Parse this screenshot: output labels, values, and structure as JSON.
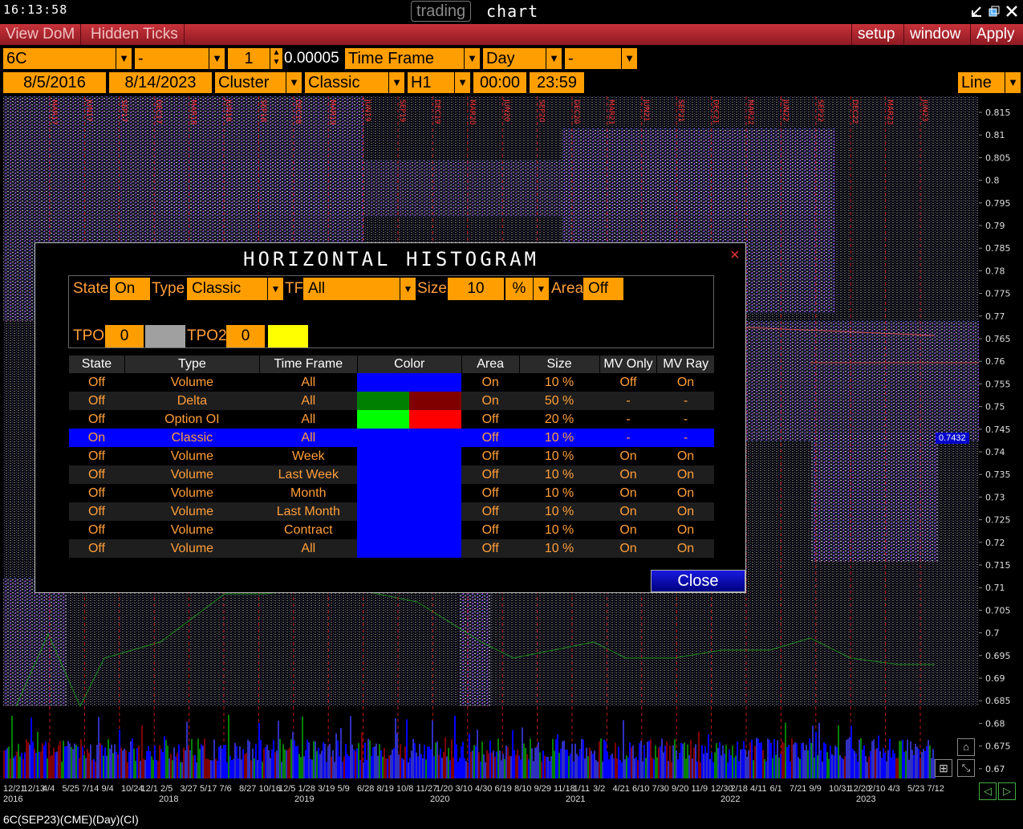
{
  "titlebar": {
    "clock": "16:13:58",
    "app_name_a": "trading",
    "app_name_b": "chart"
  },
  "toolbar": {
    "left_buttons": [
      "View DoM",
      "Hidden Ticks"
    ],
    "right_buttons": [
      "setup",
      "window",
      "Apply"
    ]
  },
  "controls_row1": {
    "symbol": "6C",
    "field2": "-",
    "multiplier": "1",
    "tick_size": "0.00005",
    "timeframe_label": "Time Frame",
    "period": "Day",
    "field7": "-"
  },
  "controls_row2": {
    "start_date": "8/5/2016",
    "end_date": "8/14/2023",
    "chart_type": "Cluster",
    "style": "Classic",
    "interval": "H1",
    "start_time": "00:00",
    "end_time": "23:59",
    "display": "Line"
  },
  "price_axis": [
    "0.815",
    "0.81",
    "0.805",
    "0.8",
    "0.795",
    "0.79",
    "0.785",
    "0.78",
    "0.775",
    "0.77",
    "0.765",
    "0.76",
    "0.755",
    "0.75",
    "0.745",
    "0.74",
    "0.735",
    "0.73",
    "0.725",
    "0.72",
    "0.715",
    "0.71",
    "0.705",
    "0.7",
    "0.695",
    "0.69",
    "0.685",
    "0.68",
    "0.675",
    "0.67"
  ],
  "current_price": "0.7432",
  "month_markers": [
    "MAR17",
    "JUN17",
    "SEP17",
    "DEC17",
    "MAR18",
    "JUN18",
    "SEP18",
    "DEC18",
    "MAR19",
    "JUN19",
    "SEP19",
    "DEC19",
    "MAR20",
    "JUN20",
    "SEP20",
    "DEC20",
    "MAR21",
    "JUN21",
    "SEP21",
    "DEC21",
    "MAR22",
    "JUN22",
    "SEP22",
    "DEC22",
    "MAR23",
    "JUN23"
  ],
  "date_axis": {
    "ticks": [
      "12/21",
      "12/13",
      "4/4",
      "5/25",
      "7/14",
      "9/4",
      "10/24",
      "12/1",
      "2/5",
      "3/27",
      "5/17",
      "7/6",
      "8/27",
      "10/16",
      "12/5",
      "1/28",
      "3/19",
      "5/9",
      "6/28",
      "8/19",
      "10/8",
      "11/27",
      "1/20",
      "3/10",
      "4/30",
      "6/19",
      "8/10",
      "9/29",
      "11/18",
      "1/11",
      "3/2",
      "4/21",
      "6/10",
      "7/30",
      "9/20",
      "11/9",
      "12/30",
      "2/18",
      "4/11",
      "6/1",
      "7/21",
      "9/9",
      "10/31",
      "12/20",
      "2/10",
      "4/3",
      "5/23",
      "7/12"
    ],
    "years": [
      "2016",
      "2018",
      "2019",
      "2020",
      "2021",
      "2022",
      "2023"
    ]
  },
  "status": "6C(SEP23)(CME)(Day)(CI)",
  "dialog": {
    "title": "HORIZONTAL HISTOGRAM",
    "close_x": "×",
    "options": {
      "state_label": "State",
      "state_value": "On",
      "type_label": "Type",
      "type_value": "Classic",
      "tf_label": "TF",
      "tf_value": "All",
      "size_label": "Size",
      "size_value": "10",
      "size_unit": "%",
      "area_label": "Area",
      "area_value": "Off",
      "tpo_label": "TPO",
      "tpo_value": "0",
      "tpo_color": "#a0a0a0",
      "tpo2_label": "TPO2",
      "tpo2_value": "0",
      "tpo2_color": "#ffff00"
    },
    "table": {
      "headers": [
        "State",
        "Type",
        "Time Frame",
        "Color",
        "Area",
        "Size",
        "MV Only",
        "MV Ray"
      ],
      "rows": [
        {
          "state": "Off",
          "type": "Volume",
          "tf": "All",
          "colors": [
            "#0000ff"
          ],
          "area": "On",
          "size": "10 %",
          "mv_only": "Off",
          "mv_ray": "On"
        },
        {
          "state": "Off",
          "type": "Delta",
          "tf": "All",
          "colors": [
            "#008000",
            "#800000"
          ],
          "area": "On",
          "size": "50 %",
          "mv_only": "-",
          "mv_ray": "-"
        },
        {
          "state": "Off",
          "type": "Option OI",
          "tf": "All",
          "colors": [
            "#00ff00",
            "#ff0000"
          ],
          "area": "Off",
          "size": "20 %",
          "mv_only": "-",
          "mv_ray": "-"
        },
        {
          "state": "On",
          "type": "Classic",
          "tf": "All",
          "colors": [
            "#0000ff"
          ],
          "area": "Off",
          "size": "10 %",
          "mv_only": "-",
          "mv_ray": "-",
          "selected": true
        },
        {
          "state": "Off",
          "type": "Volume",
          "tf": "Week",
          "colors": [
            "#0000ff"
          ],
          "area": "Off",
          "size": "10 %",
          "mv_only": "On",
          "mv_ray": "On"
        },
        {
          "state": "Off",
          "type": "Volume",
          "tf": "Last Week",
          "colors": [
            "#0000ff"
          ],
          "area": "Off",
          "size": "10 %",
          "mv_only": "On",
          "mv_ray": "On"
        },
        {
          "state": "Off",
          "type": "Volume",
          "tf": "Month",
          "colors": [
            "#0000ff"
          ],
          "area": "Off",
          "size": "10 %",
          "mv_only": "On",
          "mv_ray": "On"
        },
        {
          "state": "Off",
          "type": "Volume",
          "tf": "Last Month",
          "colors": [
            "#0000ff"
          ],
          "area": "Off",
          "size": "10 %",
          "mv_only": "On",
          "mv_ray": "On"
        },
        {
          "state": "Off",
          "type": "Volume",
          "tf": "Contract",
          "colors": [
            "#0000ff"
          ],
          "area": "Off",
          "size": "10 %",
          "mv_only": "On",
          "mv_ray": "On"
        },
        {
          "state": "Off",
          "type": "Volume",
          "tf": "All",
          "colors": [
            "#0000ff"
          ],
          "area": "Off",
          "size": "10 %",
          "mv_only": "On",
          "mv_ray": "On"
        }
      ]
    },
    "close_button": "Close"
  }
}
